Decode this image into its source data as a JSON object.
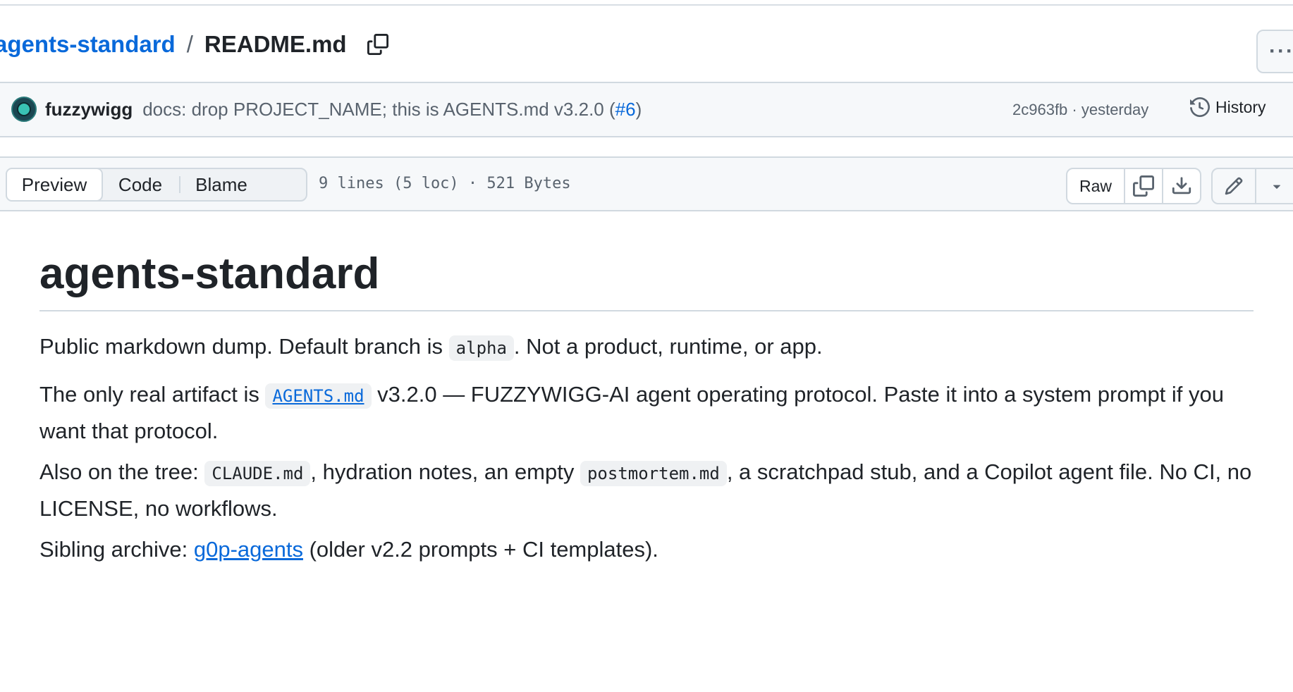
{
  "breadcrumb": {
    "repo": "agents-standard",
    "separator": "/",
    "file": "README.md",
    "more_label": "···"
  },
  "commit": {
    "author": "fuzzywigg",
    "message": "docs: drop PROJECT_NAME; this is AGENTS.md v3.2.0 (",
    "pr_link": "#6",
    "message_end": ")",
    "sha_time": "2c963fb · yesterday",
    "history_label": "History"
  },
  "file_header": {
    "tabs": [
      "Preview",
      "Code",
      "Blame"
    ],
    "active_tab": "Preview",
    "info": "9 lines (5 loc) · 521 Bytes",
    "raw_label": "Raw"
  },
  "readme": {
    "title": "agents-standard",
    "p1": {
      "before": "Public markdown dump. Default branch is ",
      "code": "alpha",
      "after": ". Not a product, runtime, or app."
    },
    "p2": {
      "before": "The only real artifact is ",
      "code_link": "AGENTS.md",
      "after": " v3.2.0 — FUZZYWIGG-AI agent operating protocol. Paste it into a system prompt if you want that protocol."
    },
    "p3": {
      "before": "Also on the tree: ",
      "code1": "CLAUDE.md",
      "middle": ", hydration notes, an empty ",
      "code2": "postmortem.md",
      "after": ", a scratchpad stub, and a Copilot agent file. No CI, no LICENSE, no workflows."
    },
    "p4": {
      "before": "Sibling archive: ",
      "link": "g0p-agents",
      "after": " (older v2.2 prompts + CI templates)."
    }
  },
  "colors": {
    "link": "#0969da",
    "text": "#1f2328",
    "muted": "#59636e",
    "border": "#d1d9e0",
    "subtle_bg": "#f6f8fa"
  },
  "icons": [
    "copy-icon",
    "kebab-icon",
    "avatar",
    "history-icon",
    "copy-icon",
    "download-icon",
    "pencil-icon",
    "caret-down-icon"
  ]
}
